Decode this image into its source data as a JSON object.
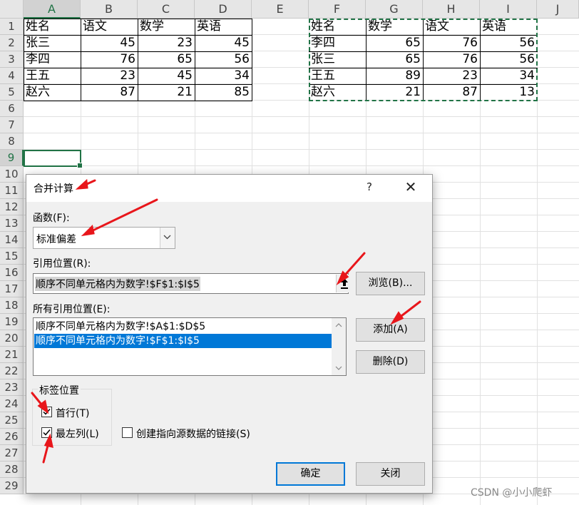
{
  "sheet": {
    "columns": [
      "A",
      "B",
      "C",
      "D",
      "E",
      "F",
      "G",
      "H",
      "I",
      "J"
    ],
    "rows": [
      "1",
      "2",
      "3",
      "4",
      "5",
      "6",
      "7",
      "8",
      "9",
      "10",
      "11",
      "12",
      "13",
      "14",
      "15",
      "16",
      "17",
      "18",
      "19",
      "20",
      "21",
      "22",
      "23",
      "24",
      "25",
      "26",
      "27",
      "28",
      "29"
    ],
    "table1": {
      "header": [
        "姓名",
        "语文",
        "数学",
        "英语"
      ],
      "rows": [
        [
          "张三",
          "45",
          "23",
          "45"
        ],
        [
          "李四",
          "76",
          "65",
          "56"
        ],
        [
          "王五",
          "23",
          "45",
          "34"
        ],
        [
          "赵六",
          "87",
          "21",
          "85"
        ]
      ]
    },
    "table2": {
      "header": [
        "姓名",
        "数学",
        "语文",
        "英语"
      ],
      "rows": [
        [
          "李四",
          "65",
          "76",
          "56"
        ],
        [
          "张三",
          "65",
          "76",
          "56"
        ],
        [
          "王五",
          "89",
          "23",
          "34"
        ],
        [
          "赵六",
          "21",
          "87",
          "13"
        ]
      ]
    },
    "accent_color": "#217346"
  },
  "dialog": {
    "title": "合并计算",
    "help": "?",
    "close": "✕",
    "function_label": "函数(F):",
    "function_value": "标准偏差",
    "reference_label": "引用位置(R):",
    "reference_value": "顺序不同单元格内为数字!$F$1:$I$5",
    "browse_button": "浏览(B)...",
    "all_references_label": "所有引用位置(E):",
    "all_references": [
      "顺序不同单元格内为数字!$A$1:$D$5",
      "顺序不同单元格内为数字!$F$1:$I$5"
    ],
    "add_button": "添加(A)",
    "delete_button": "删除(D)",
    "labels_group": "标签位置",
    "top_row": "首行(T)",
    "left_column": "最左列(L)",
    "link_source": "创建指向源数据的链接(S)",
    "ok_button": "确定",
    "close_button": "关闭",
    "selection_color": "#0078d7"
  },
  "watermark": "CSDN @小小爬虾"
}
